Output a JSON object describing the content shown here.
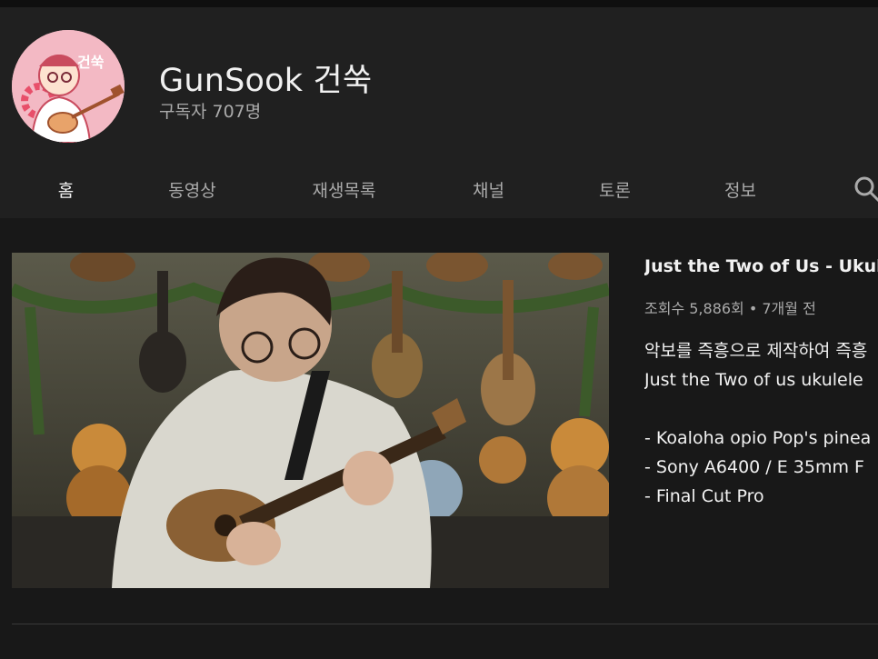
{
  "channel": {
    "name": "GunSook 건쑥",
    "subscribers": "구독자 707명",
    "avatar_text": "건쑥"
  },
  "tabs": [
    {
      "label": "홈",
      "active": true
    },
    {
      "label": "동영상",
      "active": false
    },
    {
      "label": "재생목록",
      "active": false
    },
    {
      "label": "채널",
      "active": false
    },
    {
      "label": "토론",
      "active": false
    },
    {
      "label": "정보",
      "active": false
    }
  ],
  "search": {
    "icon": "search-icon"
  },
  "featured_video": {
    "title": "Just the Two of Us - Ukule",
    "meta": "조회수 5,886회 • 7개월 전",
    "description": [
      "악보를 즉흥으로 제작하여 즉흥",
      "Just the Two of us ukulele",
      "",
      "- Koaloha opio Pop's pinea",
      "- Sony A6400 / E 35mm F",
      "- Final Cut Pro"
    ]
  },
  "colors": {
    "background": "#181818",
    "header": "#202020",
    "text": "#f1f1f1",
    "secondary_text": "#aaaaaa"
  }
}
